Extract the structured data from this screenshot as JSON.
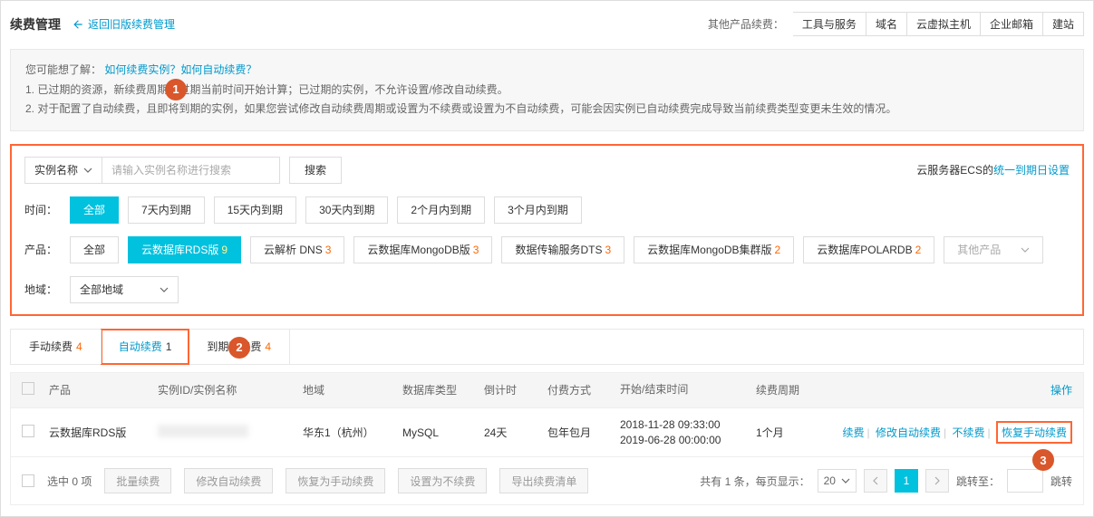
{
  "header": {
    "title": "续费管理",
    "back_link": "返回旧版续费管理",
    "other_label": "其他产品续费：",
    "other_tabs": [
      "工具与服务",
      "域名",
      "云虚拟主机",
      "企业邮箱",
      "建站"
    ]
  },
  "info": {
    "prefix": "您可能想了解：",
    "links": "如何续费实例？如何自动续费？",
    "line1": "1. 已过期的资源，新续费周期从过期当前时间开始计算；已过期的实例，不允许设置/修改自动续费。",
    "line2": "2. 对于配置了自动续费，且即将到期的实例，如果您尝试修改自动续费周期或设置为不续费或设置为不自动续费，可能会因实例已自动续费完成导致当前续费类型变更未生效的情况。"
  },
  "filter": {
    "name_dropdown": "实例名称",
    "search_placeholder": "请输入实例名称进行搜索",
    "search_btn": "搜索",
    "ecs_right": "云服务器ECS的",
    "ecs_link": "统一到期日设置",
    "time_label": "时间：",
    "time_opts": [
      "全部",
      "7天内到期",
      "15天内到期",
      "30天内到期",
      "2个月内到期",
      "3个月内到期"
    ],
    "prod_label": "产品：",
    "prod_opts": [
      {
        "label": "全部",
        "count": ""
      },
      {
        "label": "云数据库RDS版",
        "count": "9"
      },
      {
        "label": "云解析 DNS",
        "count": "3"
      },
      {
        "label": "云数据库MongoDB版",
        "count": "3"
      },
      {
        "label": "数据传输服务DTS",
        "count": "3"
      },
      {
        "label": "云数据库MongoDB集群版",
        "count": "2"
      },
      {
        "label": "云数据库POLARDB",
        "count": "2"
      }
    ],
    "other_prod": "其他产品",
    "region_label": "地域：",
    "region_value": "全部地域"
  },
  "tabs": [
    {
      "label": "手动续费",
      "count": "4"
    },
    {
      "label": "自动续费",
      "count": "1"
    },
    {
      "label": "到期不续费",
      "count": "4"
    }
  ],
  "table": {
    "headers": {
      "prod": "产品",
      "id": "实例ID/实例名称",
      "region": "地域",
      "dbtype": "数据库类型",
      "countdown": "倒计时",
      "paytype": "付费方式",
      "time": "开始/结束时间",
      "cycle": "续费周期",
      "action": "操作"
    },
    "row": {
      "prod": "云数据库RDS版",
      "region": "华东1（杭州）",
      "dbtype": "MySQL",
      "countdown": "24天",
      "paytype": "包年包月",
      "time_start": "2018-11-28 09:33:00",
      "time_end": "2019-06-28 00:00:00",
      "cycle": "1个月",
      "actions": {
        "renew": "续费",
        "modify": "修改自动续费",
        "norenew": "不续费",
        "restore": "恢复手动续费"
      }
    }
  },
  "footer": {
    "selected": "选中 0 项",
    "batch_renew": "批量续费",
    "modify_auto": "修改自动续费",
    "restore_manual": "恢复为手动续费",
    "set_norenew": "设置为不续费",
    "export": "导出续费清单",
    "total": "共有 1 条，每页显示：",
    "page_size": "20",
    "page_num": "1",
    "jump_label": "跳转至：",
    "jump_btn": "跳转"
  },
  "badges": {
    "b1": "1",
    "b2": "2",
    "b3": "3"
  }
}
